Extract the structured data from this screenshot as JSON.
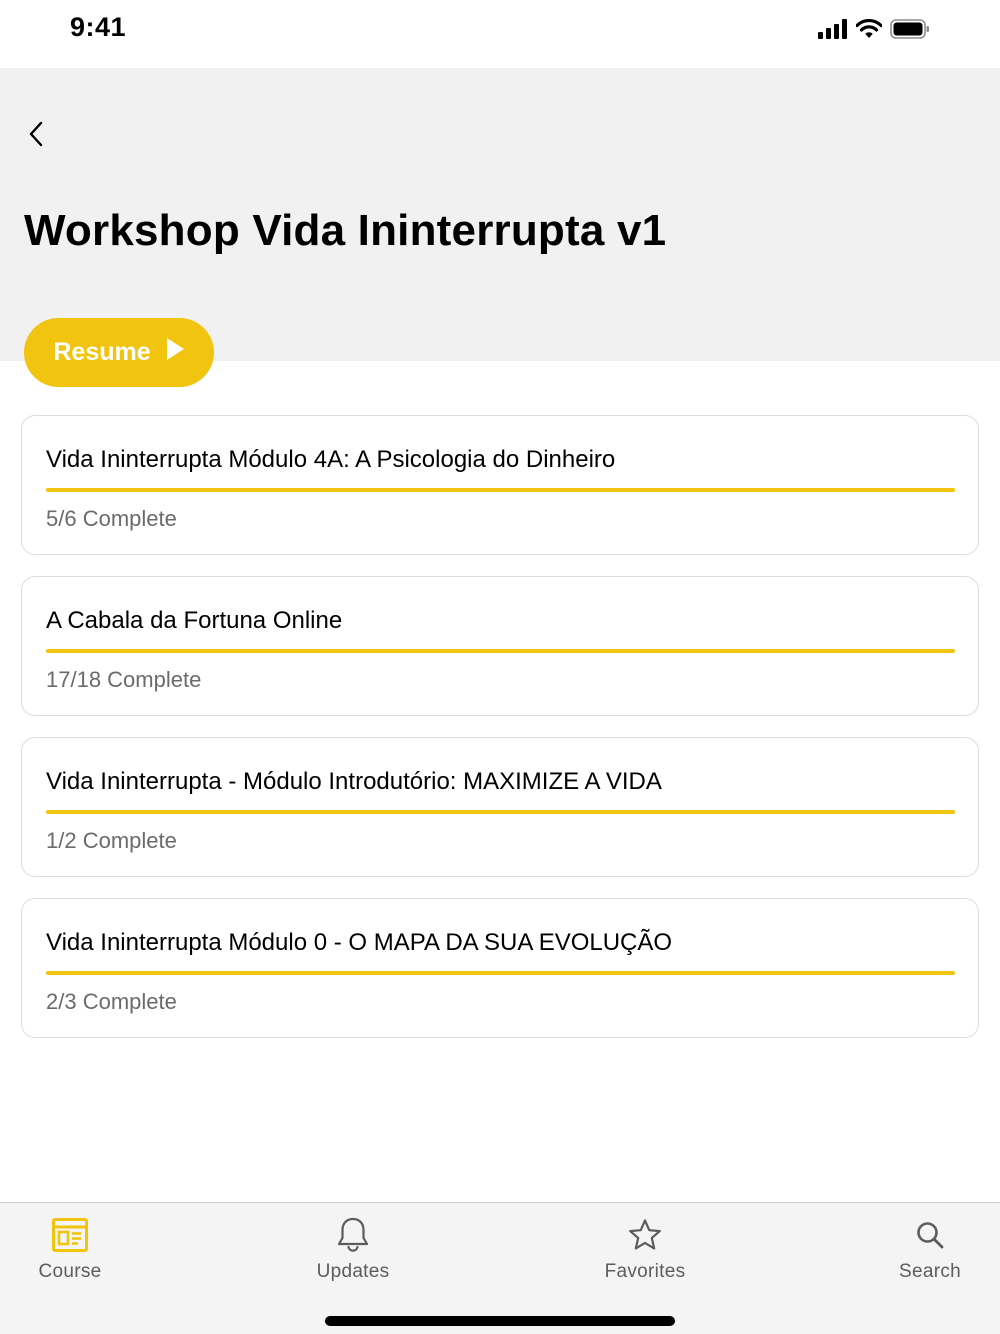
{
  "status_bar": {
    "time": "9:41"
  },
  "header": {
    "title": "Workshop Vida Ininterrupta v1"
  },
  "resume_button": {
    "label": "Resume"
  },
  "colors": {
    "accent": "#f1c40f",
    "header_bg": "#f1f1f1",
    "muted_text": "#6b6b6b"
  },
  "modules": [
    {
      "title": "Vida Ininterrupta Módulo 4A: A Psicologia do Dinheiro",
      "status": "5/6 Complete"
    },
    {
      "title": "A Cabala da Fortuna Online",
      "status": "17/18 Complete"
    },
    {
      "title": "Vida Ininterrupta - Módulo Introdutório: MAXIMIZE A VIDA",
      "status": "1/2 Complete"
    },
    {
      "title": "Vida Ininterrupta Módulo 0 - O MAPA DA SUA EVOLUÇÃO",
      "status": "2/3 Complete"
    }
  ],
  "tab_bar": {
    "tabs": [
      {
        "label": "Course",
        "icon": "course-icon",
        "active": true
      },
      {
        "label": "Updates",
        "icon": "bell-icon",
        "active": false
      },
      {
        "label": "Favorites",
        "icon": "star-icon",
        "active": false
      },
      {
        "label": "Search",
        "icon": "search-icon",
        "active": false
      }
    ]
  }
}
